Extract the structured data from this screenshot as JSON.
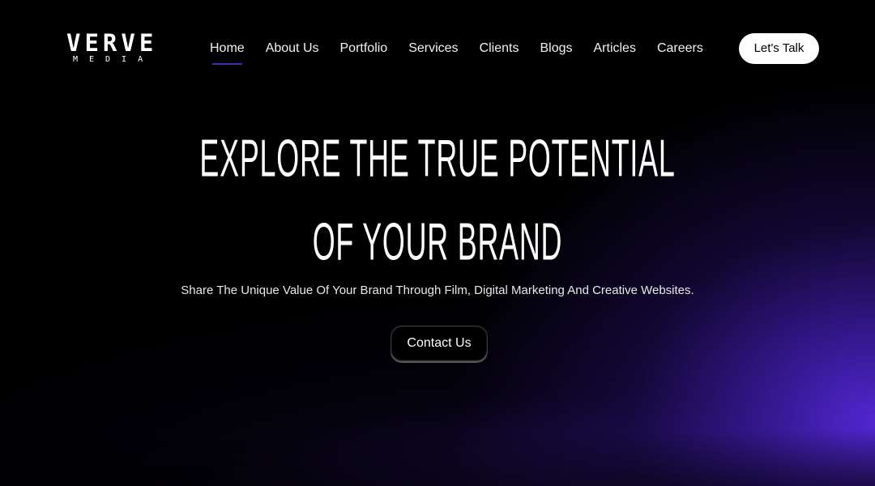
{
  "logo": {
    "main": "VERVE",
    "sub": "MEDIA"
  },
  "nav": {
    "items": [
      {
        "label": "Home",
        "active": true
      },
      {
        "label": "About Us"
      },
      {
        "label": "Portfolio"
      },
      {
        "label": "Services"
      },
      {
        "label": "Clients"
      },
      {
        "label": "Blogs"
      },
      {
        "label": "Articles"
      },
      {
        "label": "Careers"
      }
    ],
    "cta_label": "Let's Talk"
  },
  "hero": {
    "title_line_1": "EXPLORE THE TRUE POTENTIAL",
    "title_line_2": "OF YOUR BRAND",
    "subtitle": "Share The Unique Value Of Your Brand Through Film, Digital Marketing And Creative Websites.",
    "cta_label": "Contact Us"
  },
  "colors": {
    "background": "#000000",
    "accent_glow": "#5628dc",
    "active_underline": "#3c2fa8",
    "button_light": "#ffffff"
  }
}
